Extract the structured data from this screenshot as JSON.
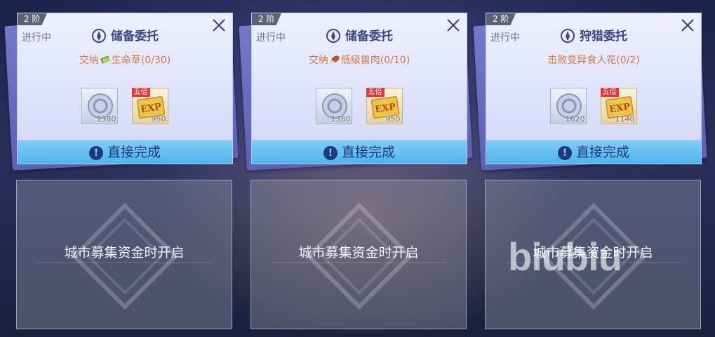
{
  "accent_colors": {
    "button": "#4fb3ec",
    "objective_text": "#d2793a",
    "badge": "#e2383a"
  },
  "quests": [
    {
      "tier": "2 阶",
      "status": "进行中",
      "title": "储备委托",
      "objective_prefix": "交纳",
      "objective_item_icon": "cash-bundle-icon",
      "objective_name": "生命草",
      "objective_progress": "(0/30)",
      "rewards": [
        {
          "icon": "silver-coin-icon",
          "amount": "1380"
        },
        {
          "icon": "exp-ticket-icon",
          "badge": "五倍",
          "amount": "950"
        }
      ],
      "complete_label": "直接完成"
    },
    {
      "tier": "2 阶",
      "status": "进行中",
      "title": "储备委托",
      "objective_prefix": "交纳",
      "objective_item_icon": "meat-icon",
      "objective_name": "低级兽肉",
      "objective_progress": "(0/10)",
      "rewards": [
        {
          "icon": "silver-coin-icon",
          "amount": "1380"
        },
        {
          "icon": "exp-ticket-icon",
          "badge": "五倍",
          "amount": "950"
        }
      ],
      "complete_label": "直接完成"
    },
    {
      "tier": "2 阶",
      "status": "进行中",
      "title": "狩猎委托",
      "objective_prefix": "",
      "objective_item_icon": "",
      "objective_name": "击败变异食人花",
      "objective_progress": "(0/2)",
      "rewards": [
        {
          "icon": "silver-coin-icon",
          "amount": "1620"
        },
        {
          "icon": "exp-ticket-icon",
          "badge": "五倍",
          "amount": "1140"
        }
      ],
      "complete_label": "直接完成"
    }
  ],
  "locked_slots": [
    {
      "message": "城市募集资金时开启"
    },
    {
      "message": "城市募集资金时开启"
    },
    {
      "message": "城市募集资金时开启"
    }
  ],
  "watermark": "biubiu"
}
